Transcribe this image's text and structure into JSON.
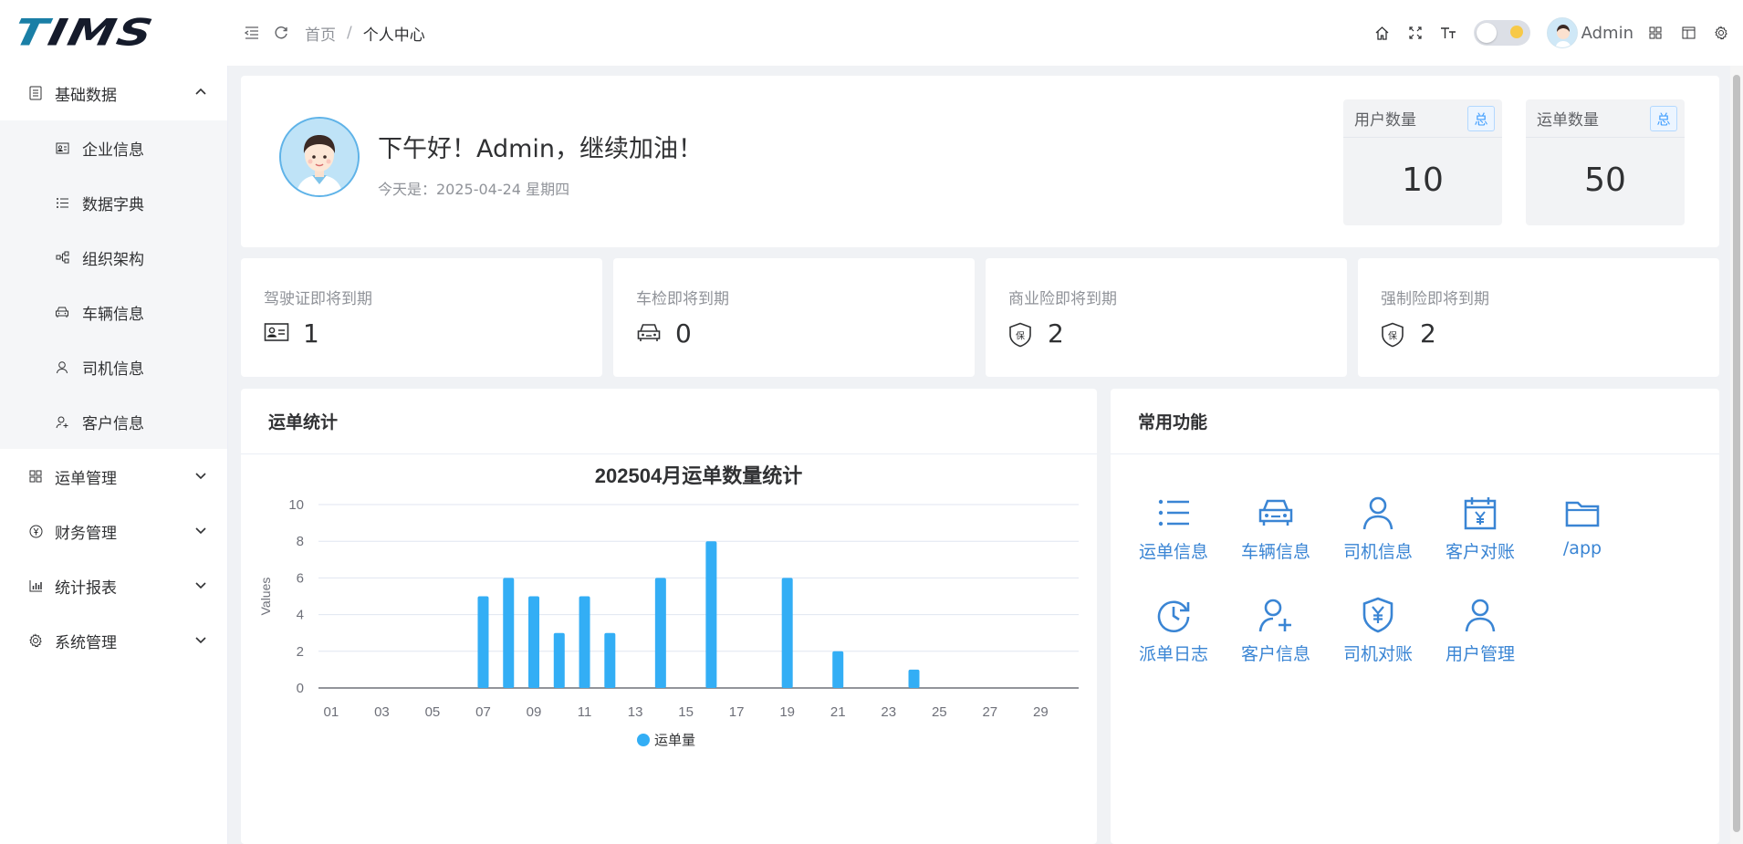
{
  "logo": {
    "text_t": "T",
    "text_rest": "IMS"
  },
  "header": {
    "breadcrumb": [
      "首页",
      "个人中心"
    ],
    "breadcrumb_sep": "/",
    "user_name": "Admin",
    "icons": [
      "fold-icon",
      "refresh-icon",
      "home-icon",
      "fullscreen-icon",
      "font-size-icon",
      "theme-toggle",
      "layout-icon",
      "window-icon",
      "settings-icon"
    ]
  },
  "sidebar": {
    "groups": [
      {
        "label": "基础数据",
        "icon": "document-icon",
        "expanded": true,
        "items": [
          {
            "label": "企业信息",
            "icon": "id-card-icon"
          },
          {
            "label": "数据字典",
            "icon": "list-icon"
          },
          {
            "label": "组织架构",
            "icon": "org-tree-icon"
          },
          {
            "label": "车辆信息",
            "icon": "car-icon"
          },
          {
            "label": "司机信息",
            "icon": "person-icon"
          },
          {
            "label": "客户信息",
            "icon": "customer-icon"
          }
        ]
      },
      {
        "label": "运单管理",
        "icon": "grid-icon",
        "expanded": false
      },
      {
        "label": "财务管理",
        "icon": "yen-circle-icon",
        "expanded": false
      },
      {
        "label": "统计报表",
        "icon": "bar-chart-icon",
        "expanded": false
      },
      {
        "label": "系统管理",
        "icon": "gear-icon",
        "expanded": false
      }
    ]
  },
  "welcome": {
    "greeting": "下午好！Admin，继续加油！",
    "today": "今天是：2025-04-24 星期四"
  },
  "stats": [
    {
      "label": "用户数量",
      "tag": "总",
      "value": "10"
    },
    {
      "label": "运单数量",
      "tag": "总",
      "value": "50"
    }
  ],
  "expiry": [
    {
      "label": "驾驶证即将到期",
      "icon": "license-icon",
      "value": "1"
    },
    {
      "label": "车检即将到期",
      "icon": "car-icon",
      "value": "0"
    },
    {
      "label": "商业险即将到期",
      "icon": "insurance-shield-icon",
      "value": "2"
    },
    {
      "label": "强制险即将到期",
      "icon": "insurance-shield-icon",
      "value": "2"
    }
  ],
  "insurance_glyph": "保",
  "chart_panel": {
    "title": "运单统计"
  },
  "chart_data": {
    "type": "bar",
    "title": "202504月运单数量统计",
    "xlabel": "",
    "ylabel": "Values",
    "ylim": [
      0,
      10
    ],
    "yticks": [
      0,
      2,
      4,
      6,
      8,
      10
    ],
    "categories": [
      "01",
      "02",
      "03",
      "04",
      "05",
      "06",
      "07",
      "08",
      "09",
      "10",
      "11",
      "12",
      "13",
      "14",
      "15",
      "16",
      "17",
      "18",
      "19",
      "20",
      "21",
      "22",
      "23",
      "24",
      "25",
      "26",
      "27",
      "28",
      "29",
      "30"
    ],
    "xticks": [
      "01",
      "03",
      "05",
      "07",
      "09",
      "11",
      "13",
      "15",
      "17",
      "19",
      "21",
      "23",
      "25",
      "27",
      "29"
    ],
    "series": [
      {
        "name": "运单量",
        "color": "#33aef5",
        "values": [
          0,
          0,
          0,
          0,
          0,
          0,
          5,
          6,
          5,
          3,
          5,
          3,
          0,
          6,
          0,
          8,
          0,
          0,
          6,
          0,
          2,
          0,
          0,
          1,
          0,
          0,
          0,
          0,
          0,
          0
        ]
      }
    ],
    "legend": "bottom-center",
    "grid": true
  },
  "func_panel": {
    "title": "常用功能",
    "items": [
      {
        "label": "运单信息",
        "icon": "list-icon"
      },
      {
        "label": "车辆信息",
        "icon": "car-icon"
      },
      {
        "label": "司机信息",
        "icon": "person-icon"
      },
      {
        "label": "客户对账",
        "icon": "calendar-yen-icon"
      },
      {
        "label": "/app",
        "icon": "folder-icon"
      },
      {
        "label": "派单日志",
        "icon": "clock-refresh-icon"
      },
      {
        "label": "客户信息",
        "icon": "person-add-icon"
      },
      {
        "label": "司机对账",
        "icon": "shield-yen-icon"
      },
      {
        "label": "用户管理",
        "icon": "person-icon"
      }
    ]
  },
  "colors": {
    "accent": "#409eff",
    "chart_bar": "#33aef5",
    "func_icon": "#3a85d4"
  }
}
